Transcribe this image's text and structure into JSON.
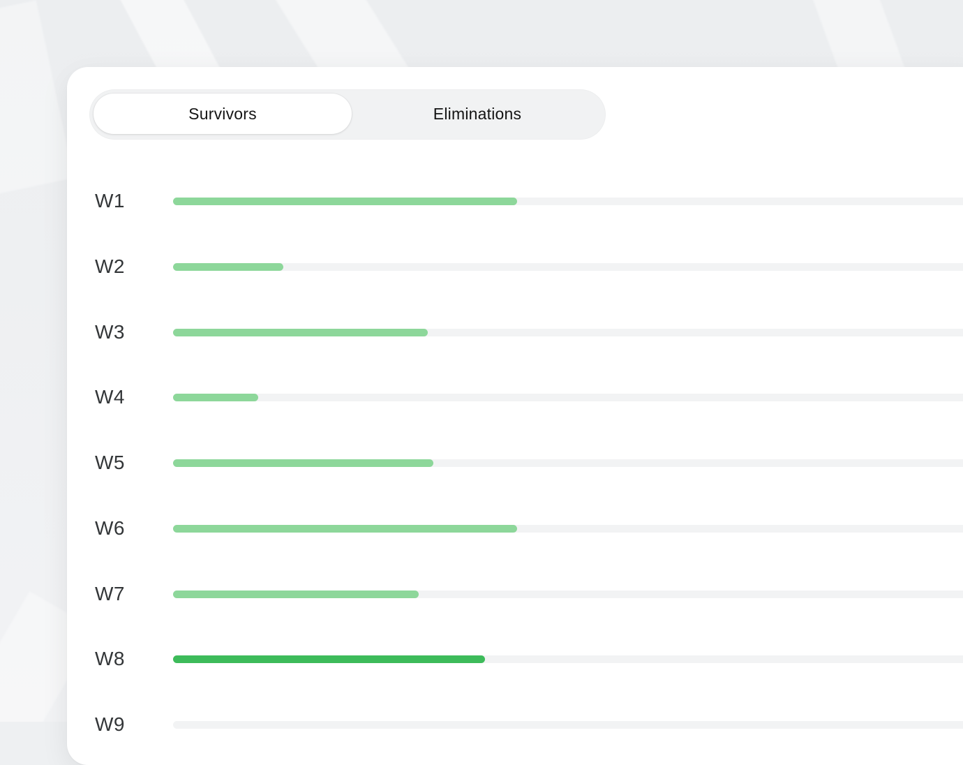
{
  "tabs": [
    {
      "label": "Survivors",
      "active": true
    },
    {
      "label": "Eliminations",
      "active": false
    }
  ],
  "rows": [
    {
      "label": "W1",
      "progress": 0.415
    },
    {
      "label": "W2",
      "progress": 0.133
    },
    {
      "label": "W3",
      "progress": 0.307
    },
    {
      "label": "W4",
      "progress": 0.103
    },
    {
      "label": "W5",
      "progress": 0.314
    },
    {
      "label": "W6",
      "progress": 0.415
    },
    {
      "label": "W7",
      "progress": 0.296
    },
    {
      "label": "W8",
      "progress": 0.376,
      "highlight": true
    },
    {
      "label": "W9",
      "progress": 0.0
    }
  ],
  "colors": {
    "fill": "#8dd79a",
    "fill_highlight": "#3dbb5a",
    "track": "#f2f3f4",
    "card": "#ffffff",
    "segmented_bg": "#f1f2f3"
  }
}
